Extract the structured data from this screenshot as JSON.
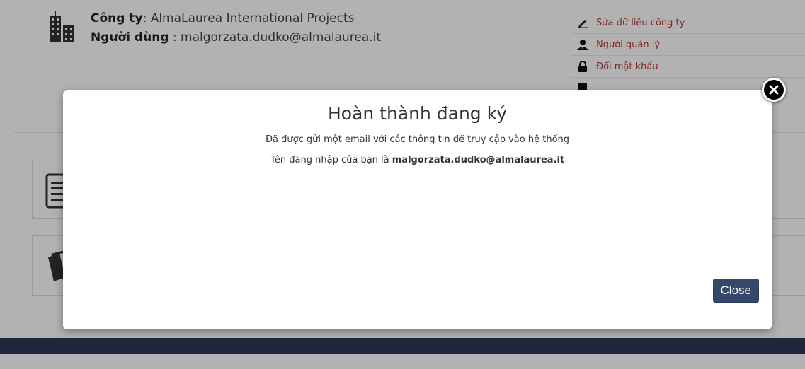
{
  "company": {
    "label": "Công ty",
    "value": ": AlmaLaurea International Projects"
  },
  "user": {
    "label": "Người dùng",
    "value": " : malgorzata.dudko@almalaurea.it"
  },
  "links": [
    {
      "icon": "pencil-icon",
      "label": "Sửa dữ liệu công ty"
    },
    {
      "icon": "manager-icon",
      "label": "Người quản lý"
    },
    {
      "icon": "lock-icon",
      "label": "Đổi mật khẩu"
    }
  ],
  "modal": {
    "title": "Hoàn thành đang ký",
    "line1": "Đã được gửi một email với các thông tin để truy cập vào hệ thống",
    "line2_prefix": "Tên đăng nhập của bạn là ",
    "line2_username": "malgorzata.dudko@almalaurea.it",
    "close_label": "Close"
  },
  "colors": {
    "link_text": "#b33a3a",
    "close_button": "#34496a",
    "dark_band": "#2a3a55"
  }
}
